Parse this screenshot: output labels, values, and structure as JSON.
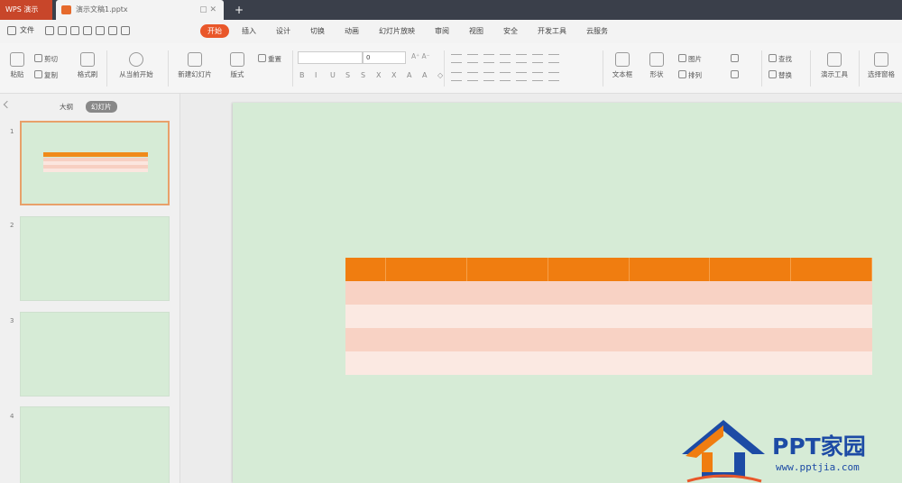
{
  "titlebar": {
    "app_label": "WPS 演示",
    "doc_tab_label": "演示文稿1.pptx",
    "new_tab": "+"
  },
  "menubar": {
    "file_label": "文件",
    "tabs": [
      "开始",
      "插入",
      "设计",
      "切换",
      "动画",
      "幻灯片放映",
      "审阅",
      "视图",
      "安全",
      "开发工具",
      "云服务"
    ],
    "active_tab": "开始"
  },
  "ribbon": {
    "paste": "粘贴",
    "cut": "剪切",
    "copy": "复制",
    "format_painter": "格式刷",
    "from_current": "从当前开始",
    "new_slide": "新建幻灯片",
    "layout": "版式",
    "reset": "重置",
    "font_size": "0",
    "textbox": "文本框",
    "shape": "形状",
    "picture": "图片",
    "arrange": "排列",
    "find": "查找",
    "replace": "替换",
    "presenter_tools": "演示工具",
    "select_pane": "选择窗格"
  },
  "sidepanel": {
    "tab_outline": "大纲",
    "tab_slides": "幻灯片",
    "slide_numbers": [
      "1",
      "2",
      "3",
      "4"
    ]
  },
  "watermark": {
    "brand": "PPT家园",
    "url": "www.pptjia.com"
  },
  "colors": {
    "accent": "#e9572a",
    "table_header": "#f07d10",
    "table_row_a": "#f8d2c4",
    "table_row_b": "#fbe9e2",
    "slide_bg": "#d6ebd6"
  }
}
